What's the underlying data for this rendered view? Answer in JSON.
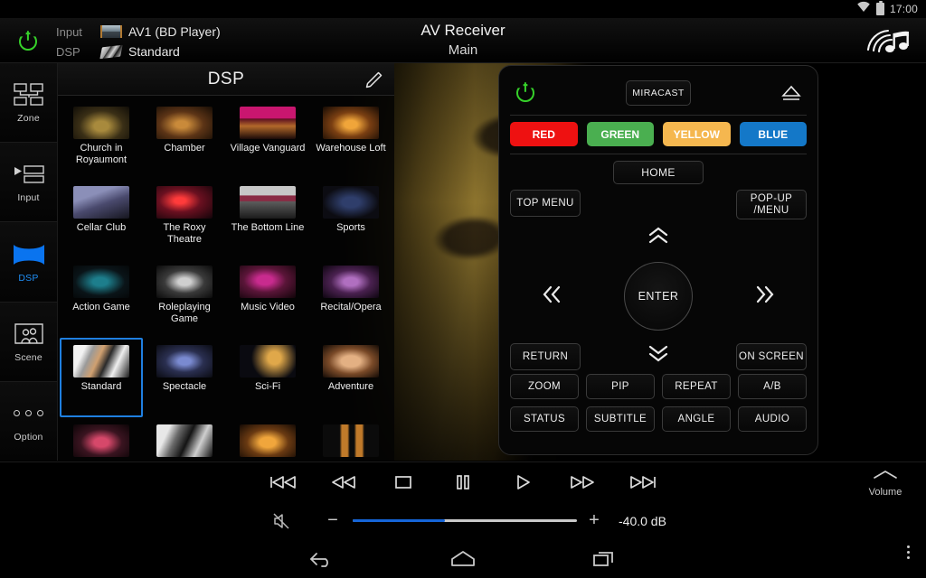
{
  "statusbar": {
    "time": "17:00",
    "wifi_icon": "wifi-icon",
    "battery_icon": "battery-icon"
  },
  "header": {
    "power_icon": "power-icon",
    "input_label": "Input",
    "input_value": "AV1 (BD Player)",
    "input_icon": "input-source-icon",
    "dsp_label": "DSP",
    "dsp_value": "Standard",
    "dsp_icon": "dsp-field-icon",
    "title": "AV Receiver",
    "subtitle": "Main",
    "brand_icon": "musiccast-logo-icon"
  },
  "sidebar": {
    "items": [
      {
        "label": "Zone",
        "icon": "zone-icon",
        "active": false
      },
      {
        "label": "Input",
        "icon": "input-icon",
        "active": false
      },
      {
        "label": "DSP",
        "icon": "dsp-icon",
        "active": true
      },
      {
        "label": "Scene",
        "icon": "scene-icon",
        "active": false
      },
      {
        "label": "Option",
        "icon": "option-icon",
        "active": false
      }
    ]
  },
  "dsp_panel": {
    "title": "DSP",
    "edit_icon": "pencil-edit-icon",
    "selected": "Standard",
    "presets": [
      {
        "name": "Church in Royaumont",
        "art": "th-church"
      },
      {
        "name": "Chamber",
        "art": "th-chamber"
      },
      {
        "name": "Village Vanguard",
        "art": "th-village"
      },
      {
        "name": "Warehouse Loft",
        "art": "th-warehouse"
      },
      {
        "name": "Cellar Club",
        "art": "th-cellar"
      },
      {
        "name": "The Roxy Theatre",
        "art": "th-roxy"
      },
      {
        "name": "The Bottom Line",
        "art": "th-bottom"
      },
      {
        "name": "Sports",
        "art": "th-sports"
      },
      {
        "name": "Action Game",
        "art": "th-action"
      },
      {
        "name": "Roleplaying Game",
        "art": "th-rpg"
      },
      {
        "name": "Music Video",
        "art": "th-music"
      },
      {
        "name": "Recital/Opera",
        "art": "th-recital"
      },
      {
        "name": "Standard",
        "art": "th-standard"
      },
      {
        "name": "Spectacle",
        "art": "th-spectacle"
      },
      {
        "name": "Sci-Fi",
        "art": "th-scifi"
      },
      {
        "name": "Adventure",
        "art": "th-adventure"
      },
      {
        "name": "",
        "art": "th-drama"
      },
      {
        "name": "",
        "art": "th-mono"
      },
      {
        "name": "",
        "art": "th-theater"
      },
      {
        "name": "",
        "art": "th-speaker"
      }
    ]
  },
  "remote": {
    "power_icon": "power-icon",
    "miracast": "MIRACAST",
    "eject_icon": "eject-icon",
    "color_buttons": [
      {
        "label": "RED",
        "color": "#ee1111"
      },
      {
        "label": "GREEN",
        "color": "#4aaf50"
      },
      {
        "label": "YELLOW",
        "color": "#f5b74f"
      },
      {
        "label": "BLUE",
        "color": "#1478c8"
      }
    ],
    "home": "HOME",
    "top_menu": "TOP MENU",
    "popup_menu": "POP-UP /MENU",
    "enter": "ENTER",
    "up_icon": "chevron-up-icon",
    "down_icon": "chevron-down-icon",
    "left_icon": "chevron-left-icon",
    "right_icon": "chevron-right-icon",
    "return": "RETURN",
    "on_screen": "ON SCREEN",
    "grid_buttons": [
      "ZOOM",
      "PIP",
      "REPEAT",
      "A/B",
      "STATUS",
      "SUBTITLE",
      "ANGLE",
      "AUDIO"
    ]
  },
  "transport": {
    "buttons": [
      {
        "icon": "skip-previous-icon"
      },
      {
        "icon": "rewind-icon"
      },
      {
        "icon": "stop-icon"
      },
      {
        "icon": "pause-icon"
      },
      {
        "icon": "play-icon"
      },
      {
        "icon": "fast-forward-icon"
      },
      {
        "icon": "skip-next-icon"
      }
    ],
    "volume_corner_label": "Volume",
    "volume_corner_icon": "chevron-up-icon"
  },
  "volume": {
    "mute_icon": "mute-icon",
    "minus": "−",
    "plus": "+",
    "value": "-40.0 dB",
    "fill_percent": 41
  },
  "navbar": {
    "back_icon": "back-icon",
    "home_icon": "home-icon",
    "recents_icon": "recents-icon",
    "overflow_icon": "overflow-menu-icon"
  }
}
